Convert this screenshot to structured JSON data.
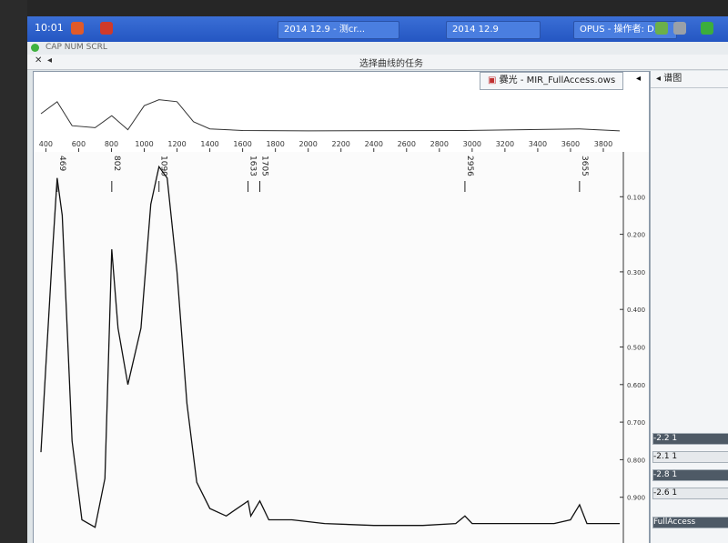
{
  "taskbar": {
    "clock": "10:01",
    "items": [
      "OPUS - 操作者: D...",
      "2014 12.9",
      "2014 12.9 - 测cr..."
    ]
  },
  "statusbar": {
    "text": "CAP NUM SCRL"
  },
  "toolbar2": {
    "label": "选择曲线的任务"
  },
  "window": {
    "tab_title": "爨光 - MIR_FullAccess.ows"
  },
  "right_panel": {
    "title": "谱图",
    "rows": [
      "-2.6 1",
      "-2.8 1",
      "-2.1 1",
      "-2.2 1"
    ],
    "footer": "FullAccess"
  },
  "chart_data": {
    "type": "line",
    "xlabel": "",
    "ylabel": "",
    "x_ticks": [
      400,
      600,
      800,
      1000,
      1200,
      1400,
      1600,
      1800,
      2000,
      2200,
      2400,
      2600,
      2800,
      3000,
      3200,
      3400,
      3600,
      3800
    ],
    "y_ticks": [
      "0.100",
      "0.200",
      "0.300",
      "0.400",
      "0.500",
      "0.600",
      "0.700",
      "0.800",
      "0.900"
    ],
    "peak_labels": [
      "469",
      "802",
      "1090",
      "1633",
      "1705",
      "2956",
      "3655"
    ],
    "series": [
      {
        "x": [
          370,
          400,
          440,
          469,
          500,
          560,
          620,
          700,
          760,
          802,
          840,
          900,
          980,
          1040,
          1090,
          1140,
          1200,
          1260,
          1320,
          1400,
          1500,
          1633,
          1650,
          1705,
          1760,
          1900,
          2100,
          2400,
          2700,
          2900,
          2956,
          3000,
          3200,
          3500,
          3600,
          3655,
          3700,
          3800,
          3900
        ],
        "y": [
          0.78,
          0.55,
          0.25,
          0.05,
          0.15,
          0.75,
          0.96,
          0.98,
          0.85,
          0.24,
          0.45,
          0.6,
          0.45,
          0.12,
          0.02,
          0.05,
          0.3,
          0.65,
          0.86,
          0.93,
          0.95,
          0.91,
          0.95,
          0.91,
          0.96,
          0.96,
          0.97,
          0.975,
          0.975,
          0.97,
          0.95,
          0.97,
          0.97,
          0.97,
          0.96,
          0.92,
          0.97,
          0.97,
          0.97
        ]
      }
    ]
  },
  "overview_data": {
    "x": [
      370,
      469,
      560,
      700,
      802,
      900,
      1000,
      1090,
      1200,
      1300,
      1400,
      1600,
      2000,
      2956,
      3655,
      3900
    ],
    "y": [
      0.5,
      0.2,
      0.8,
      0.85,
      0.55,
      0.9,
      0.3,
      0.15,
      0.2,
      0.7,
      0.88,
      0.92,
      0.93,
      0.92,
      0.88,
      0.93
    ]
  }
}
